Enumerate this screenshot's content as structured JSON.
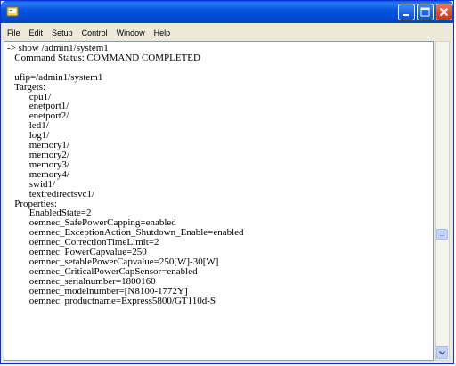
{
  "window": {
    "title": "",
    "buttons": {
      "minimize": "–",
      "maximize": "□",
      "close": "✕"
    }
  },
  "menu": {
    "items": [
      "File",
      "Edit",
      "Setup",
      "Control",
      "Window",
      "Help"
    ]
  },
  "terminal": {
    "lines": [
      "-> show /admin1/system1",
      "   Command Status: COMMAND COMPLETED",
      "",
      "   ufip=/admin1/system1",
      "   Targets:",
      "         cpu1/",
      "         enetport1/",
      "         enetport2/",
      "         led1/",
      "         log1/",
      "         memory1/",
      "         memory2/",
      "         memory3/",
      "         memory4/",
      "         swid1/",
      "         textredirectsvc1/",
      "   Properties:",
      "         EnabledState=2",
      "         oemnec_SafePowerCapping=enabled",
      "         oemnec_ExceptionAction_Shutdown_Enable=enabled",
      "         oemnec_CorrectionTimeLimit=2",
      "         oemnec_PowerCapvalue=250",
      "         oemnec_setablePowerCapvalue=250[W]-30[W]",
      "         oemnec_CriticalPowerCapSensor=enabled",
      "         oemnec_serialnumber=1800160",
      "         oemnec_modelnumber=[N8100-1772Y]",
      "         oemnec_productname=Express5800/GT110d-S"
    ]
  },
  "icons": {
    "app": "terminal-app-icon",
    "scroll_down": "chevron-down-icon"
  },
  "colors": {
    "titlebar": "#0a5ce5",
    "close_button": "#d9492a",
    "menubar": "#ece9d8",
    "terminal_bg": "#ffffff",
    "terminal_text": "#000000"
  }
}
